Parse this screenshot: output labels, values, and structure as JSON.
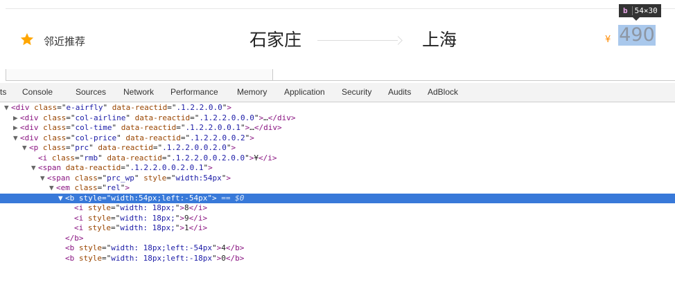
{
  "flight": {
    "recommend_label": "邻近推荐",
    "departure_city": "石家庄",
    "arrival_city": "上海",
    "currency_symbol": "¥",
    "price": "490"
  },
  "inspector_tooltip": {
    "tag": "b",
    "size": "54×30"
  },
  "devtools": {
    "tabs": [
      "ts",
      "Console",
      "Sources",
      "Network",
      "Performance",
      "Memory",
      "Application",
      "Security",
      "Audits",
      "AdBlock"
    ]
  },
  "dom_tree": [
    {
      "indent": 1,
      "arrow": "▼",
      "tag": "div",
      "attrs": [
        [
          "class",
          "e-airfly"
        ],
        [
          "data-reactid",
          ".1.2.2.0.0"
        ]
      ],
      "text": "",
      "close": ""
    },
    {
      "indent": 2,
      "arrow": "▶",
      "tag": "div",
      "attrs": [
        [
          "class",
          "col-airline"
        ],
        [
          "data-reactid",
          ".1.2.2.0.0.0"
        ]
      ],
      "text": "…",
      "close": "</div>"
    },
    {
      "indent": 2,
      "arrow": "▶",
      "tag": "div",
      "attrs": [
        [
          "class",
          "col-time"
        ],
        [
          "data-reactid",
          ".1.2.2.0.0.1"
        ]
      ],
      "text": "…",
      "close": "</div>"
    },
    {
      "indent": 2,
      "arrow": "▼",
      "tag": "div",
      "attrs": [
        [
          "class",
          "col-price"
        ],
        [
          "data-reactid",
          ".1.2.2.0.0.2"
        ]
      ],
      "text": "",
      "close": ""
    },
    {
      "indent": 3,
      "arrow": "▼",
      "tag": "p",
      "attrs": [
        [
          "class",
          "prc"
        ],
        [
          "data-reactid",
          ".1.2.2.0.0.2.0"
        ]
      ],
      "text": "",
      "close": ""
    },
    {
      "indent": 4,
      "arrow": "",
      "tag": "i",
      "attrs": [
        [
          "class",
          "rmb"
        ],
        [
          "data-reactid",
          ".1.2.2.0.0.2.0.0"
        ]
      ],
      "text": "¥",
      "close": "</i>"
    },
    {
      "indent": 4,
      "arrow": "▼",
      "tag": "span",
      "attrs": [
        [
          "data-reactid",
          ".1.2.2.0.0.2.0.1"
        ]
      ],
      "text": "",
      "close": ""
    },
    {
      "indent": 5,
      "arrow": "▼",
      "tag": "span",
      "attrs": [
        [
          "class",
          "prc_wp"
        ],
        [
          "style",
          "width:54px"
        ]
      ],
      "text": "",
      "close": ""
    },
    {
      "indent": 6,
      "arrow": "▼",
      "tag": "em",
      "attrs": [
        [
          "class",
          "rel"
        ]
      ],
      "text": "",
      "close": ""
    },
    {
      "indent": 7,
      "arrow": "▼",
      "tag": "b",
      "attrs": [
        [
          "style",
          "width:54px;left:-54px"
        ]
      ],
      "text": "",
      "close": "",
      "selected": true,
      "suffix": " == $0"
    },
    {
      "indent": 8,
      "arrow": "",
      "tag": "i",
      "attrs": [
        [
          "style",
          "width: 18px;"
        ]
      ],
      "text": "8",
      "close": "</i>"
    },
    {
      "indent": 8,
      "arrow": "",
      "tag": "i",
      "attrs": [
        [
          "style",
          "width: 18px;"
        ]
      ],
      "text": "9",
      "close": "</i>"
    },
    {
      "indent": 8,
      "arrow": "",
      "tag": "i",
      "attrs": [
        [
          "style",
          "width: 18px;"
        ]
      ],
      "text": "1",
      "close": "</i>"
    },
    {
      "indent": 7,
      "arrow": "",
      "tag": "",
      "attrs": [],
      "text": "",
      "close": "</b>"
    },
    {
      "indent": 7,
      "arrow": "",
      "tag": "b",
      "attrs": [
        [
          "style",
          "width: 18px;left:-54px"
        ]
      ],
      "text": "4",
      "close": "</b>"
    },
    {
      "indent": 7,
      "arrow": "",
      "tag": "b",
      "attrs": [
        [
          "style",
          "width: 18px;left:-18px"
        ]
      ],
      "text": "0",
      "close": "</b>"
    }
  ]
}
